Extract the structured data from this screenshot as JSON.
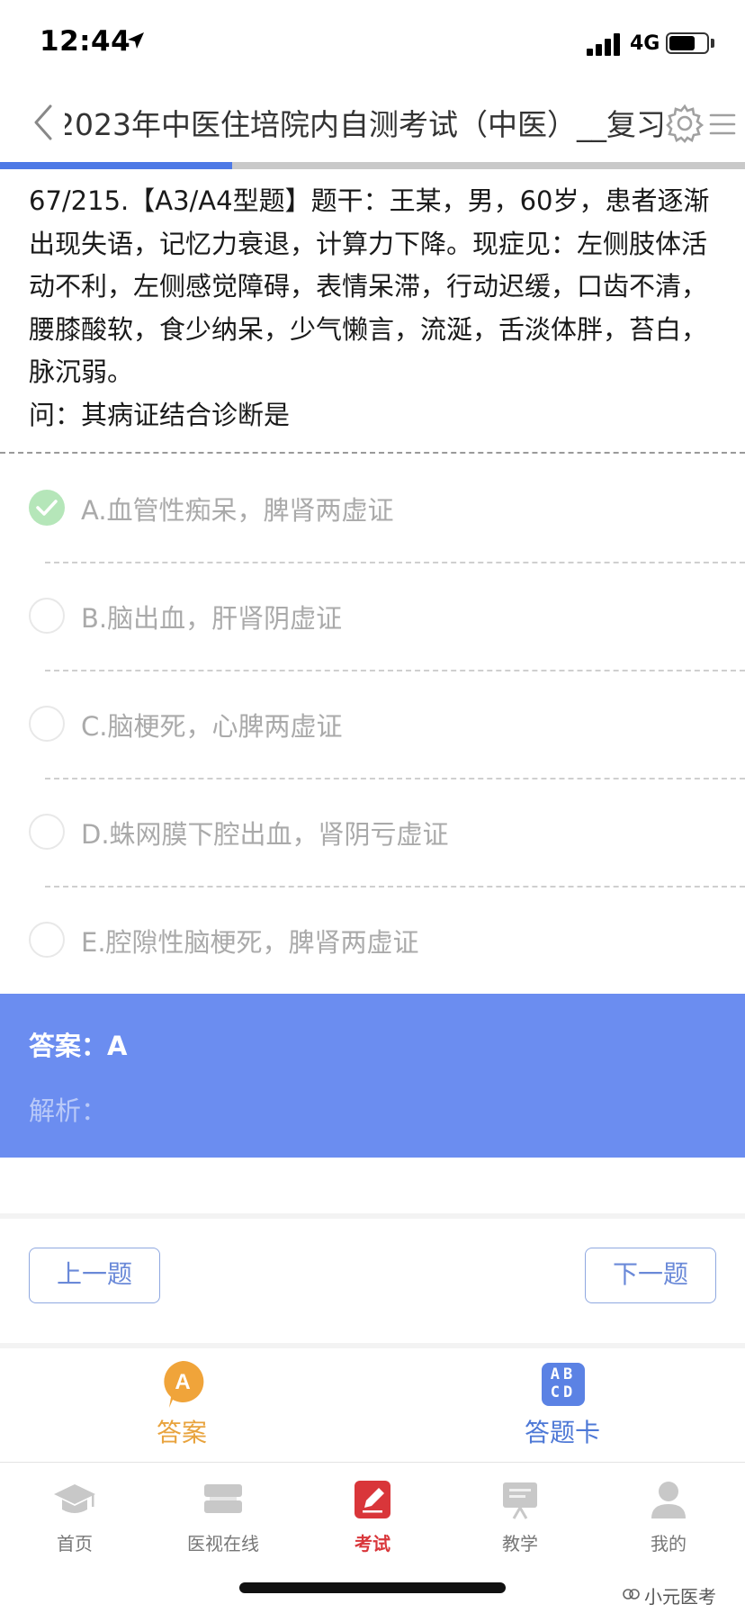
{
  "status_bar": {
    "time": "12:44",
    "network": "4G",
    "battery_level": 0.7
  },
  "nav": {
    "title": "2023年中医住培院内自测考试（中医）__复习"
  },
  "progress": {
    "current": 67,
    "total": 215
  },
  "question": {
    "text": "67/215.【A3/A4型题】题干：王某，男，60岁，患者逐渐出现失语，记忆力衰退，计算力下降。现症见：左侧肢体活动不利，左侧感觉障碍，表情呆滞，行动迟缓，口齿不清，腰膝酸软，食少纳呆，少气懒言，流涎，舌淡体胖，苔白，脉沉弱。",
    "prompt": "问：其病证结合诊断是"
  },
  "options": [
    {
      "label": "A.血管性痴呆，脾肾两虚证",
      "selected": true
    },
    {
      "label": "B.脑出血，肝肾阴虚证",
      "selected": false
    },
    {
      "label": "C.脑梗死，心脾两虚证",
      "selected": false
    },
    {
      "label": "D.蛛网膜下腔出血，肾阴亏虚证",
      "selected": false
    },
    {
      "label": "E.腔隙性脑梗死，脾肾两虚证",
      "selected": false
    }
  ],
  "answer": {
    "label": "答案：",
    "value": "A",
    "analysis_label": "解析："
  },
  "navigation": {
    "prev": "上一题",
    "next": "下一题"
  },
  "tools": {
    "answer": "答案",
    "answer_icon_letter": "A",
    "card": "答题卡",
    "card_icon_letters": [
      "AB",
      "CD"
    ]
  },
  "tabs": [
    {
      "label": "首页",
      "icon": "graduation-cap-icon"
    },
    {
      "label": "医视在线",
      "icon": "video-stack-icon"
    },
    {
      "label": "考试",
      "icon": "exam-pen-icon",
      "active": true
    },
    {
      "label": "教学",
      "icon": "teaching-board-icon"
    },
    {
      "label": "我的",
      "icon": "user-icon"
    }
  ],
  "watermark": "小元医考",
  "colors": {
    "accent": "#4d79e6",
    "answer_panel": "#6b8df0",
    "active_tab": "#d9363a",
    "answer_orange": "#e8a33d",
    "check_green": "#b5e6b9"
  }
}
